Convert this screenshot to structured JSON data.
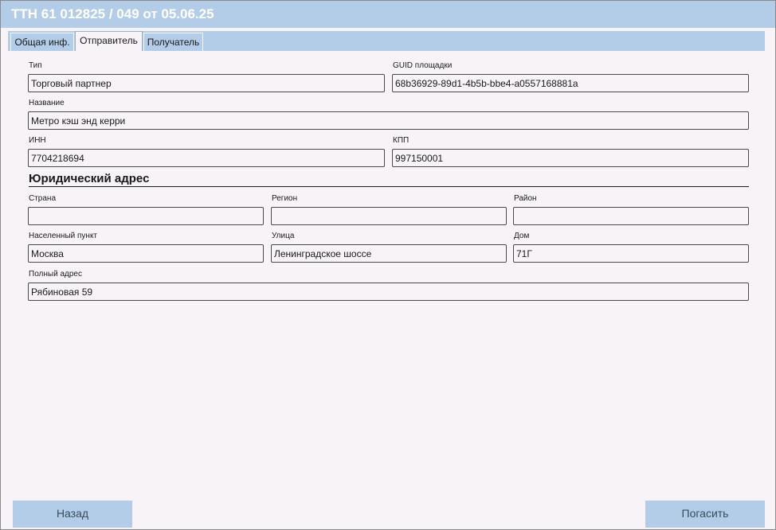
{
  "header": {
    "title": "ТТН 61 012825 / 049 от 05.06.25"
  },
  "tabs": [
    {
      "label": "Общая инф."
    },
    {
      "label": "Отправитель"
    },
    {
      "label": "Получатель"
    }
  ],
  "sender": {
    "type": {
      "label": "Тип",
      "value": "Торговый партнер"
    },
    "guid": {
      "label": "GUID площадки",
      "value": "68b36929-89d1-4b5b-bbe4-a0557168881a"
    },
    "name": {
      "label": "Название",
      "value": "Метро кэш энд керри"
    },
    "inn": {
      "label": "ИНН",
      "value": "7704218694"
    },
    "kpp": {
      "label": "КПП",
      "value": "997150001"
    }
  },
  "legal_address": {
    "title": "Юридический адрес",
    "country": {
      "label": "Страна",
      "value": ""
    },
    "region": {
      "label": "Регион",
      "value": ""
    },
    "district": {
      "label": "Район",
      "value": ""
    },
    "city": {
      "label": "Населенный пункт",
      "value": "Москва"
    },
    "street": {
      "label": "Улица",
      "value": "Ленинградское шоссе"
    },
    "house": {
      "label": "Дом",
      "value": "71Г"
    },
    "full": {
      "label": "Полный адрес",
      "value": "Рябиновая 59"
    }
  },
  "footer": {
    "back_label": "Назад",
    "redeem_label": "Погасить"
  }
}
